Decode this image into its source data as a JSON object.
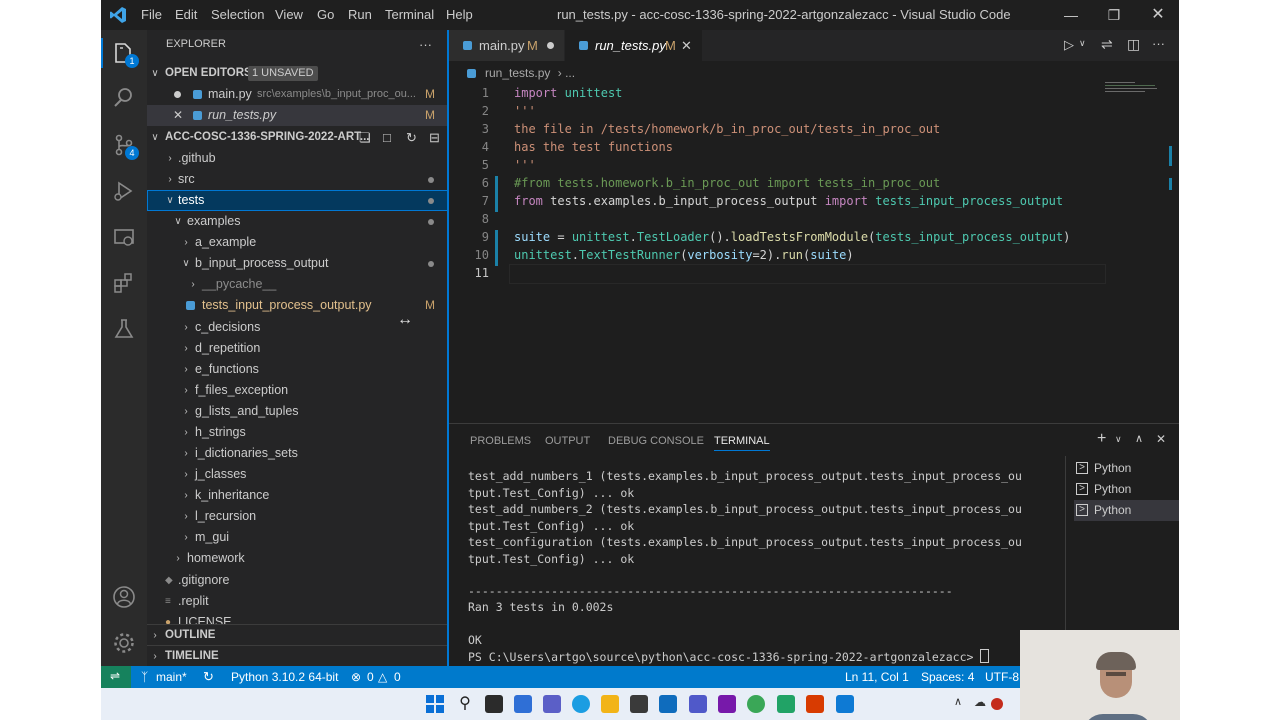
{
  "window": {
    "menu": [
      "File",
      "Edit",
      "Selection",
      "View",
      "Go",
      "Run",
      "Terminal",
      "Help"
    ],
    "title": "run_tests.py - acc-cosc-1336-spring-2022-artgonzalezacc - Visual Studio Code"
  },
  "activity": {
    "explorer_badge": "1",
    "scm_badge": "4"
  },
  "sidebar": {
    "title": "EXPLORER",
    "more": "···",
    "open_editors": {
      "label": "OPEN EDITORS",
      "badge": "1 UNSAVED",
      "items": [
        {
          "name": "main.py",
          "path": "src\\examples\\b_input_proc_ou...",
          "flag": "M"
        },
        {
          "name": "run_tests.py",
          "path": "",
          "flag": "M"
        }
      ]
    },
    "workspace": {
      "label": "ACC-COSC-1336-SPRING-2022-ART...",
      "tree": {
        "github": ".github",
        "src": "src",
        "tests": "tests",
        "examples": "examples",
        "a_example": "a_example",
        "b_input_process_output": "b_input_process_output",
        "pycache": "__pycache__",
        "tests_file": "tests_input_process_output.py",
        "tests_file_flag": "M",
        "c_decisions": "c_decisions",
        "d_repetition": "d_repetition",
        "e_functions": "e_functions",
        "f_files_exception": "f_files_exception",
        "g_lists_and_tuples": "g_lists_and_tuples",
        "h_strings": "h_strings",
        "i_dictionaries_sets": "i_dictionaries_sets",
        "j_classes": "j_classes",
        "k_inheritance": "k_inheritance",
        "l_recursion": "l_recursion",
        "m_gui": "m_gui",
        "homework": "homework",
        "gitignore": ".gitignore",
        "replit": ".replit",
        "license": "LICENSE"
      }
    },
    "outline": "OUTLINE",
    "timeline": "TIMELINE"
  },
  "tabs": [
    {
      "name": "main.py",
      "flag": "M"
    },
    {
      "name": "run_tests.py",
      "flag": "M"
    }
  ],
  "breadcrumb": {
    "file": "run_tests.py",
    "rest": "..."
  },
  "code": {
    "line_numbers": [
      "1",
      "2",
      "3",
      "4",
      "5",
      "6",
      "7",
      "8",
      "9",
      "10",
      "11"
    ],
    "l1_kw": "import",
    "l1_mod": "unittest",
    "l2": "'''",
    "l3": "the file in /tests/homework/b_in_proc_out/tests_in_proc_out",
    "l4": "has the test functions",
    "l5": "'''",
    "l6": "#from tests.homework.b_in_proc_out import tests_in_proc_out",
    "l7_from": "from",
    "l7_mod": "tests.examples.b_input_process_output",
    "l7_import": "import",
    "l7_name": "tests_input_process_output",
    "l9_var": "suite",
    "l9_eq": " = ",
    "l9_mod": "unittest",
    "l9_dot": ".",
    "l9_cls": "TestLoader",
    "l9_call": "().",
    "l9_fn": "loadTestsFromModule",
    "l9_open": "(",
    "l9_arg": "tests_input_process_output",
    "l9_close": ")",
    "l10_mod": "unittest",
    "l10_dot": ".",
    "l10_cls": "TextTestRunner",
    "l10_open": "(",
    "l10_param": "verbosity",
    "l10_eq": "=2).",
    "l10_fn": "run",
    "l10_open2": "(",
    "l10_arg": "suite",
    "l10_close": ")"
  },
  "panel": {
    "tabs": [
      "PROBLEMS",
      "OUTPUT",
      "DEBUG CONSOLE",
      "TERMINAL"
    ],
    "terminal_lines": [
      "test_add_numbers_1 (tests.examples.b_input_process_output.tests_input_process_ou",
      "tput.Test_Config) ... ok",
      "test_add_numbers_2 (tests.examples.b_input_process_output.tests_input_process_ou",
      "tput.Test_Config) ... ok",
      "test_configuration (tests.examples.b_input_process_output.tests_input_process_ou",
      "tput.Test_Config) ... ok",
      "",
      "----------------------------------------------------------------------",
      "Ran 3 tests in 0.002s",
      "",
      "OK",
      "PS C:\\Users\\artgo\\source\\python\\acc-cosc-1336-spring-2022-artgonzalezacc> "
    ],
    "terminals": [
      "Python",
      "Python",
      "Python"
    ]
  },
  "status": {
    "branch": "main*",
    "interpreter": "Python 3.10.2 64-bit",
    "errors": "0",
    "warnings": "0",
    "position": "Ln 11, Col 1",
    "spaces": "Spaces: 4",
    "encoding": "UTF-8"
  },
  "colors": {
    "accent": "#007acc",
    "keyword": "#c586c0",
    "string": "#ce9178",
    "comment": "#6a9955",
    "class": "#4ec9b0",
    "function": "#dcdcaa",
    "variable": "#9cdcfe",
    "modified": "#c9a26b"
  }
}
